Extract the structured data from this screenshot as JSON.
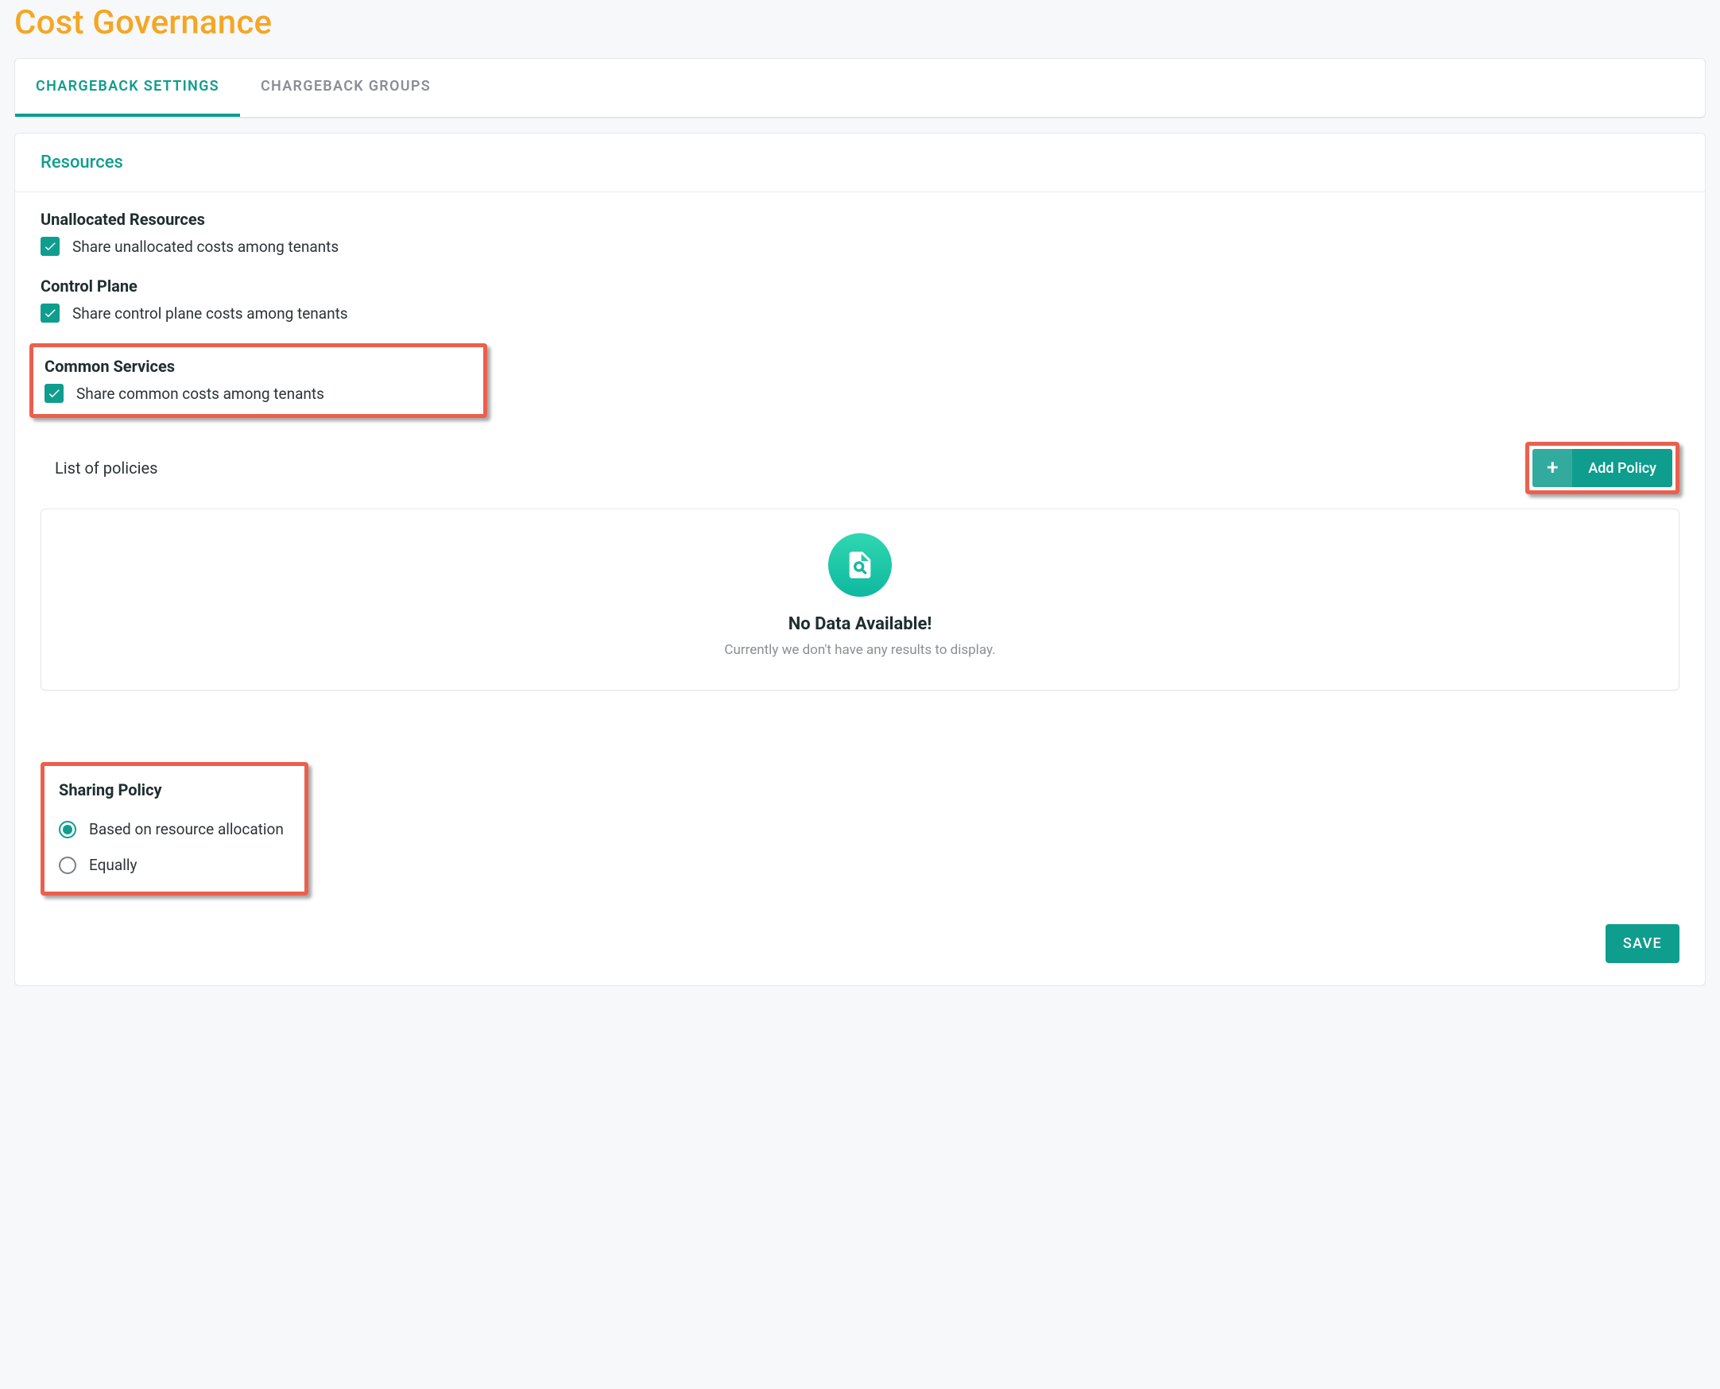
{
  "page": {
    "title": "Cost Governance"
  },
  "tabs": {
    "settings": "CHARGEBACK SETTINGS",
    "groups": "CHARGEBACK GROUPS",
    "active": "settings"
  },
  "resources": {
    "header": "Resources",
    "unallocated": {
      "title": "Unallocated Resources",
      "label": "Share unallocated costs among tenants",
      "checked": true
    },
    "control_plane": {
      "title": "Control Plane",
      "label": "Share control plane costs among tenants",
      "checked": true
    },
    "common_services": {
      "title": "Common Services",
      "label": "Share common costs among tenants",
      "checked": true
    },
    "policies": {
      "list_label": "List of policies",
      "add_label": "Add Policy",
      "empty_title": "No Data Available!",
      "empty_subtitle": "Currently we don't have any results to display."
    },
    "sharing_policy": {
      "title": "Sharing Policy",
      "options": {
        "resource_allocation": "Based on resource allocation",
        "equally": "Equally"
      },
      "selected": "resource_allocation"
    }
  },
  "actions": {
    "save": "SAVE"
  }
}
